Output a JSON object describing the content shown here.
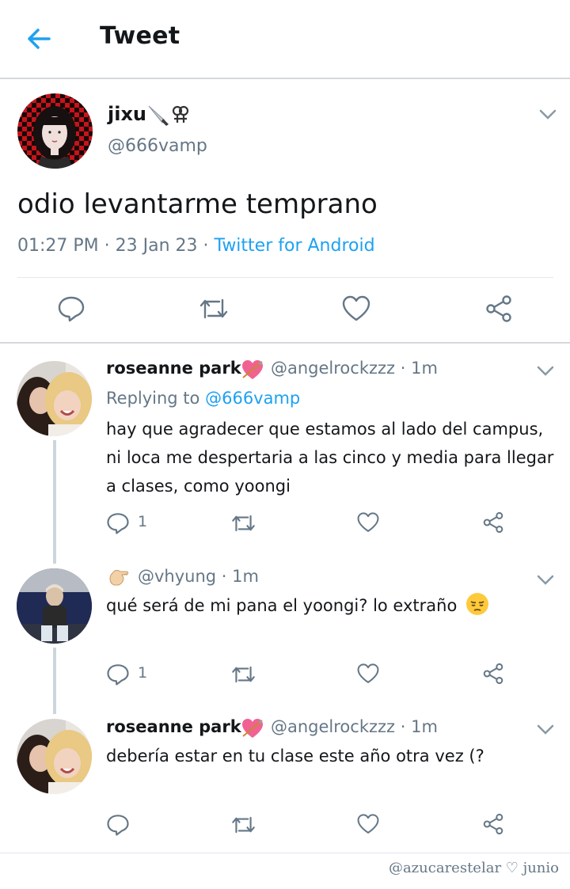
{
  "header": {
    "title": "Tweet"
  },
  "main_tweet": {
    "name": "jixu",
    "handle": "@666vamp",
    "text": "odio levantarme temprano",
    "time": "01:27 PM",
    "date": "23 Jan 23",
    "source": "Twitter for Android",
    "emoji_icons": [
      "knife-emoji",
      "female-sign-emoji"
    ]
  },
  "replies": [
    {
      "name": "roseanne park",
      "handle": "@angelrockzzz",
      "time": "1m",
      "replying_label": "Replying to",
      "replying_to": "@666vamp",
      "lines": [
        "hay que agradecer que estamos al lado del campus,",
        "ni loca me despertaria a las cinco y media para llegar",
        "a clases, como yoongi"
      ],
      "reply_count": "1"
    },
    {
      "name": "",
      "handle": "@vhyung",
      "time": "1m",
      "lines": [
        "qué será de mi pana el yoongi? lo extraño"
      ],
      "reply_count": "1"
    },
    {
      "name": "roseanne park",
      "handle": "@angelrockzzz",
      "time": "1m",
      "lines": [
        "debería estar en tu clase este año otra vez (?"
      ],
      "reply_count": ""
    }
  ],
  "watermark": "@azucarestelar ♡ junio",
  "colors": {
    "accent": "#1da1f2",
    "muted": "#657786",
    "text": "#14171a"
  }
}
